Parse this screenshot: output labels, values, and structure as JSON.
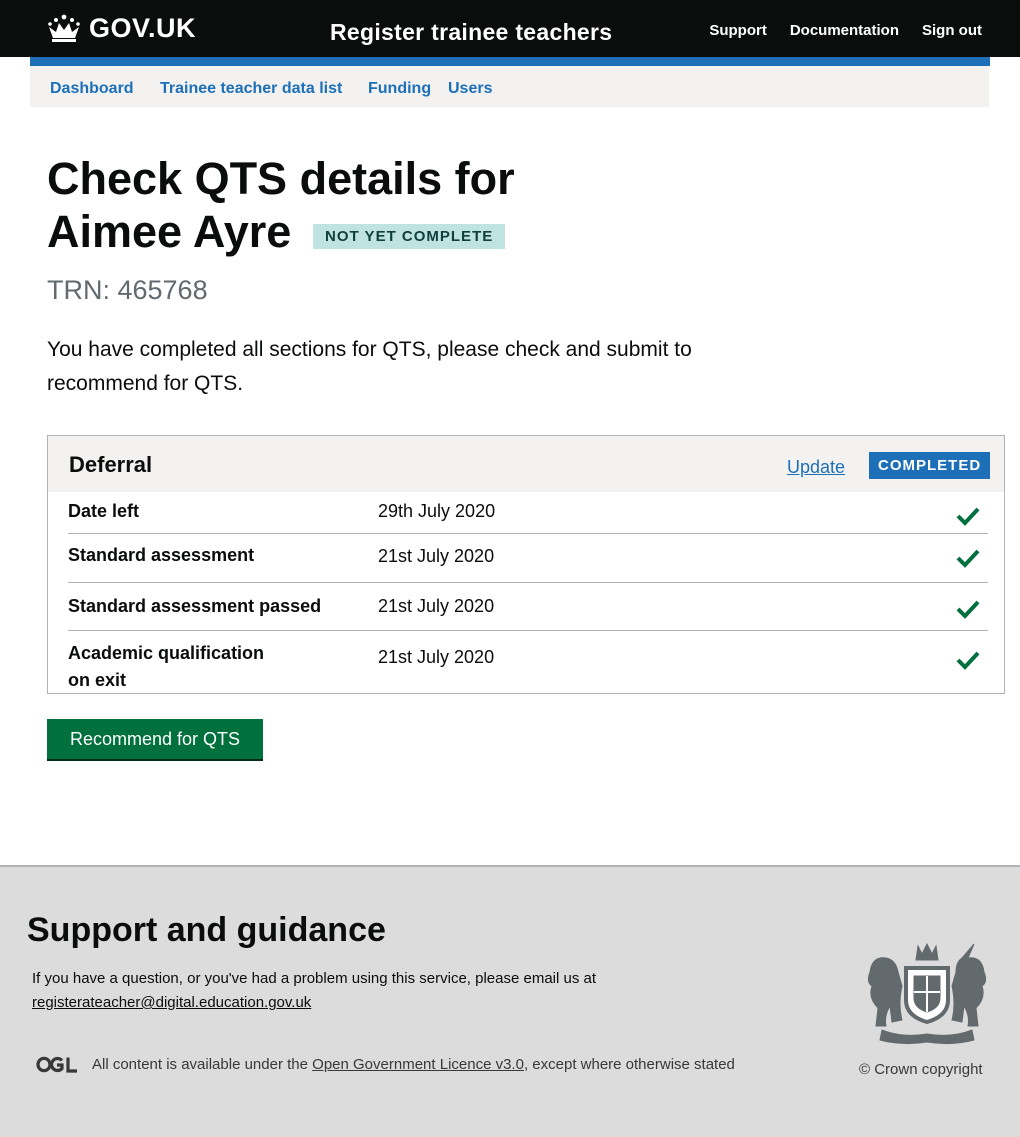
{
  "header": {
    "logo_text": "GOV.UK",
    "service_name": "Register trainee teachers",
    "links": [
      "Support",
      "Documentation",
      "Sign out"
    ]
  },
  "nav": {
    "items": [
      "Dashboard",
      "Trainee teacher data list",
      "Funding",
      "Users"
    ]
  },
  "main": {
    "title_line1": "Check QTS details for",
    "title_line2": "Aimee Ayre",
    "status_tag": "NOT YET COMPLETE",
    "trn": "TRN: 465768",
    "intro": "You have completed all sections for QTS, please check and submit to recommend for QTS."
  },
  "card": {
    "title": "Deferral",
    "update_label": "Update",
    "status_tag": "COMPLETED",
    "rows": [
      {
        "key": "Date left",
        "value": "29th July 2020"
      },
      {
        "key": "Standard assessment",
        "value": "21st  July 2020"
      },
      {
        "key": "Standard assessment passed",
        "value": "21st  July 2020"
      },
      {
        "key": "Academic qualification on exit",
        "value": "21st  July 2020"
      }
    ]
  },
  "button": {
    "label": "Recommend for  QTS"
  },
  "footer": {
    "heading": "Support and guidance",
    "help_text": "If you have a question, or you've had a problem using this service, please email us at",
    "help_email": "registerateacher@digital.education.gov.uk",
    "licence_prefix": "All content is available under the",
    "licence_link": "Open Government Licence v3.0",
    "licence_suffix": ", except where otherwise stated",
    "crown_copyright": "© Crown copyright"
  },
  "colors": {
    "header_bg": "#0b0c0c",
    "accent_blue": "#1d70b8",
    "button_green": "#00703c",
    "tick_green": "#00703c",
    "tag_turquoise_bg": "#bfe3e0",
    "footer_bg": "#dcdcdc"
  },
  "icons": [
    "crown-icon",
    "check-icon",
    "ogl-logo",
    "royal-coat-of-arms"
  ]
}
